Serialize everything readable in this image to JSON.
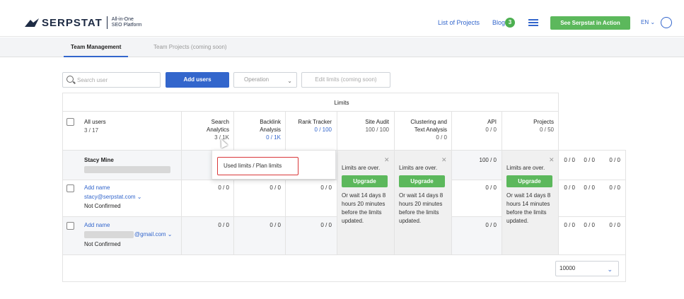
{
  "header": {
    "brand": "SERPSTAT",
    "tagline_1": "All-in-One",
    "tagline_2": "SEO Platform",
    "list_of_projects": "List of Projects",
    "blog": "Blog",
    "blog_count": "3",
    "cta": "See Serpstat in Action",
    "lang": "EN ⌄"
  },
  "tabs": {
    "team_management": "Team Management",
    "team_projects": "Team Projects (coming soon)"
  },
  "toolbar": {
    "search_placeholder": "Search user",
    "add_users": "Add users",
    "operation": "Operation",
    "edit_limits": "Edit limits (coming soon)"
  },
  "table": {
    "limits_title": "Limits",
    "columns": {
      "all_users": "All users",
      "all_users_count": "3 / 17",
      "search_1": "Search",
      "search_2": "Analytics",
      "search_val": "3 / 1K",
      "backlink_1": "Backlink",
      "backlink_2": "Analysis",
      "backlink_val": "0 / 1K",
      "rank_1": "Rank Tracker",
      "rank_val": "0 / 100",
      "audit_1": "Site Audit",
      "audit_val": "100 / 100",
      "cluster_1": "Clustering and",
      "cluster_2": "Text Analysis",
      "cluster_val": "0 / 0",
      "api_1": "API",
      "api_val": "0 / 0",
      "projects_1": "Projects",
      "projects_val": "0 / 50"
    },
    "rows": [
      {
        "name": "Stacy Mine",
        "audit": "100 / 0",
        "extra1": "0 / 0",
        "extra2": "0 / 0",
        "extra3": "0 / 0"
      },
      {
        "name": "Add name",
        "email": "stacy@serpstat.com ⌄",
        "status": "Not Confirmed",
        "search": "0 / 0",
        "backlink": "0 / 0",
        "rank": "0 / 0",
        "api": "0 / 0",
        "extra1": "0 / 0",
        "extra2": "0 / 0",
        "extra3": "0 / 0"
      },
      {
        "name": "Add name",
        "email": "@gmail.com ⌄",
        "status": "Not Confirmed",
        "search": "0 / 0",
        "backlink": "0 / 0",
        "rank": "0 / 0",
        "api": "0 / 0",
        "extra1": "0 / 0",
        "extra2": "0 / 0",
        "extra3": "0 / 0"
      }
    ],
    "limits_over": "Limits are over.",
    "upgrade": "Upgrade",
    "wait_1": "Or wait 14 days 8",
    "wait_2a": "hours 20 minutes",
    "wait_2b": "hours 14 minutes",
    "wait_3": "before the limits",
    "wait_4": "updated."
  },
  "tooltip": {
    "text": "Used limits / Plan limits"
  },
  "footer": {
    "page_size": "10000"
  },
  "colors": {
    "brand_blue": "#3366cc",
    "green": "#5cb85c",
    "tooltip_border": "#d9383a"
  }
}
